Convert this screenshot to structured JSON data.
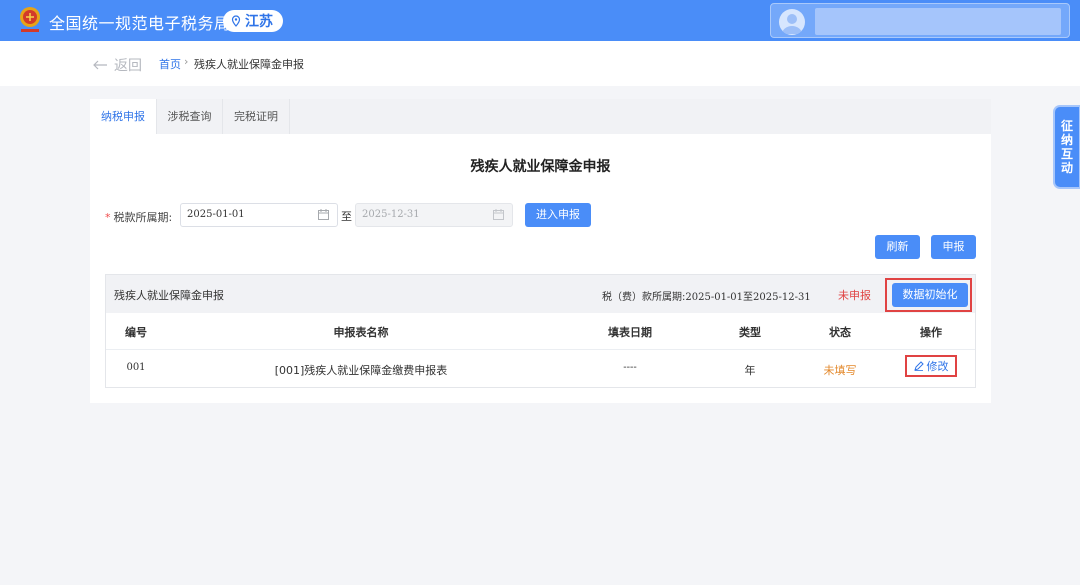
{
  "header": {
    "site_title": "全国统一规范电子税务局",
    "province": "江苏",
    "accent": "#4a8df8"
  },
  "breadcrumb": {
    "back_label": "返回",
    "home": "首页",
    "separator": "›",
    "current": "残疾人就业保障金申报"
  },
  "tabs": [
    {
      "label": "纳税申报",
      "active": true
    },
    {
      "label": "涉税查询",
      "active": false
    },
    {
      "label": "完税证明",
      "active": false
    }
  ],
  "form": {
    "title": "残疾人就业保障金申报",
    "period_label": "税款所属期:",
    "required_mark": "*",
    "start_date": "2025-01-01",
    "to_label": "至",
    "end_date": "2025-12-31",
    "enter_button": "进入申报",
    "refresh_button": "刷新",
    "declare_button": "申报"
  },
  "table_block": {
    "name": "残疾人就业保障金申报",
    "period_prefix": "税（费）款所属期:",
    "period_value": "2025-01-01至2025-12-31",
    "status": "未申报",
    "init_button": "数据初始化",
    "columns": [
      "编号",
      "申报表名称",
      "填表日期",
      "类型",
      "状态",
      "操作"
    ],
    "rows": [
      {
        "id": "001",
        "name": "[001]残疾人就业保障金缴费申报表",
        "date": "----",
        "type": "年",
        "status": "未填写",
        "action": "修改"
      }
    ]
  },
  "float_button": "征纳互动"
}
